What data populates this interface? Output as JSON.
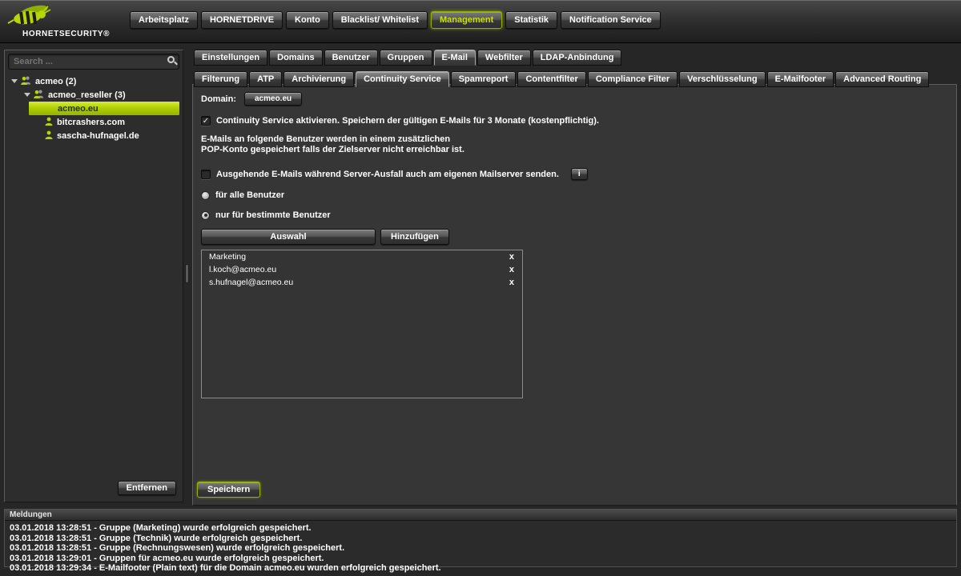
{
  "header": {
    "brand": "HORNETSECURITY®",
    "nav": [
      "Arbeitsplatz",
      "HORNETDRIVE",
      "Konto",
      "Blacklist/ Whitelist",
      "Management",
      "Statistik",
      "Notification Service"
    ]
  },
  "sidebar": {
    "search_placeholder": "Search ...",
    "tree": [
      "acmeo (2)",
      "acmeo_reseller (3)",
      "acmeo.eu",
      "bitcrashers.com",
      "sascha-hufnagel.de"
    ],
    "remove_button": "Entfernen"
  },
  "tabs": {
    "primary": [
      "Einstellungen",
      "Domains",
      "Benutzer",
      "Gruppen",
      "E-Mail",
      "Webfilter",
      "LDAP-Anbindung"
    ],
    "secondary": [
      "Filterung",
      "ATP",
      "Archivierung",
      "Continuity Service",
      "Spamreport",
      "Contentfilter",
      "Compliance Filter",
      "Verschlüsselung",
      "E-Mailfooter",
      "Advanced Routing"
    ]
  },
  "content": {
    "domain_label": "Domain:",
    "domain_value": "acmeo.eu",
    "activate_label": "Continuity Service aktivieren. Speichern der gültigen E-Mails für 3 Monate (kostenpflichtig).",
    "check_mark": "✓",
    "info_line1": "E-Mails an folgende Benutzer werden in einem zusätzlichen",
    "info_line2": "POP-Konto gespeichert falls der Zielserver nicht erreichbar ist.",
    "outgoing_label": "Ausgehende E-Mails während Server-Ausfall auch am eigenen Mailserver senden.",
    "info_button": "i",
    "radio_all": "für alle Benutzer",
    "radio_specific": "nur für bestimmte Benutzer",
    "auswahl_button": "Auswahl",
    "hinzufuegen_button": "Hinzufügen",
    "save_button": "Speichern"
  },
  "list": {
    "items": [
      "Marketing",
      "l.koch@acmeo.eu",
      "s.hufnagel@acmeo.eu"
    ],
    "remove_symbol": "x"
  },
  "messages": {
    "title": "Meldungen",
    "entries": [
      "03.01.2018 13:28:51 - Gruppe (Marketing)  wurde erfolgreich gespeichert.",
      "03.01.2018 13:28:51 - Gruppe (Technik)  wurde erfolgreich gespeichert.",
      "03.01.2018 13:28:51 - Gruppe (Rechnungswesen)  wurde erfolgreich gespeichert.",
      "03.01.2018 13:29:01 - Gruppen für acmeo.eu wurde erfolgreich gespeichert.",
      "03.01.2018 13:29:34 - E-Mailfooter (Plain text) für die Domain acmeo.eu wurden erfolgreich gespeichert."
    ]
  }
}
